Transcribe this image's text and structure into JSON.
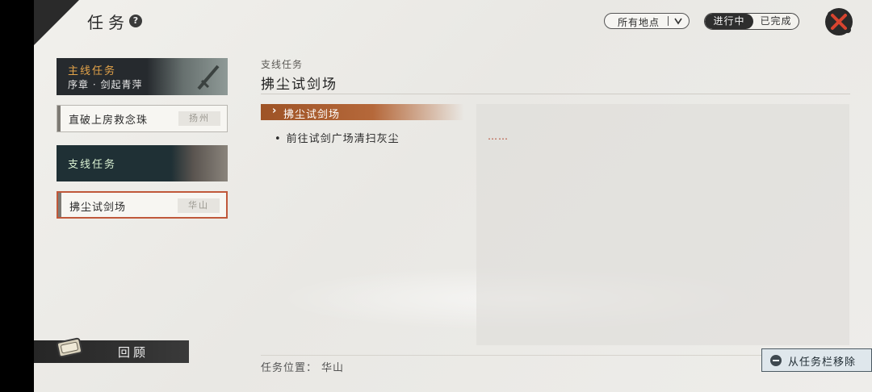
{
  "header": {
    "title": "任务",
    "help_icon": "?"
  },
  "filter": {
    "label": "所有地点",
    "icon": "chevron-down-icon"
  },
  "status_toggle": {
    "active": "进行中",
    "inactive": "已完成"
  },
  "close": {
    "icon": "close-icon"
  },
  "sidebar": {
    "main_category": {
      "title": "主线任务",
      "subtitle": "序章 · 剑起青萍"
    },
    "main_quests": [
      {
        "name": "直破上房救念珠",
        "location": "扬州"
      }
    ],
    "side_category": {
      "title": "支线任务"
    },
    "side_quests": [
      {
        "name": "拂尘试剑场",
        "location": "华山",
        "selected": true
      }
    ],
    "review_label": "回顾"
  },
  "detail": {
    "category": "支线任务",
    "title": "拂尘试剑场",
    "active_step": "拂尘试剑场",
    "sub_step": "前往试剑广场清扫灰尘",
    "description": "……",
    "location_label": "任务位置：",
    "location_value": "华山",
    "remove_label": "从任务栏移除"
  },
  "colors": {
    "accent": "#b5683a",
    "main_title": "#e3a349",
    "side_title": "#d9f0d2",
    "selected_border": "#c0583a"
  }
}
